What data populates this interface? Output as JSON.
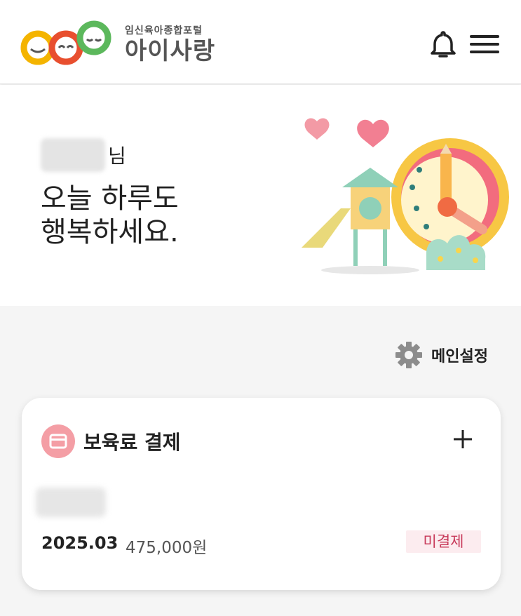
{
  "header": {
    "logo_subtitle": "임신육아종합포털",
    "logo_title": "아이사랑"
  },
  "hero": {
    "name_suffix": "님",
    "greeting_line1": "오늘 하루도",
    "greeting_line2": "행복하세요."
  },
  "settings": {
    "label": "메인설정"
  },
  "payment_card": {
    "title": "보육료 결제",
    "date": "2025.03",
    "amount": "475,000원",
    "status": "미결제"
  },
  "colors": {
    "card_icon_bg": "#f49ea5",
    "status_text": "#c83a5a",
    "status_bg": "#fcecef"
  },
  "icons": [
    "logo-mark",
    "bell-icon",
    "hamburger-menu-icon",
    "gear-icon",
    "card-icon",
    "plus-icon"
  ]
}
